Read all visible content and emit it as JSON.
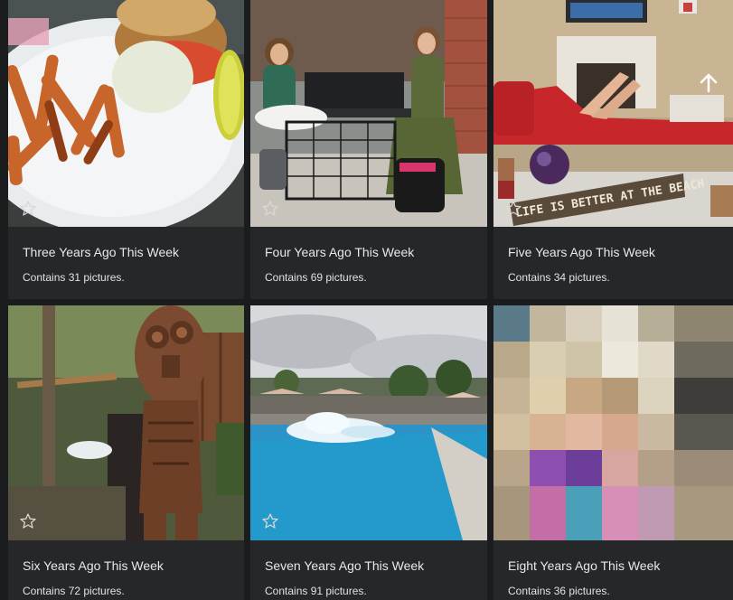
{
  "albums": [
    {
      "title": "Three Years Ago This Week",
      "count": "Contains 31 pictures.",
      "thumb": "plate-of-fries-and-sandwich-photo"
    },
    {
      "title": "Four Years Ago This Week",
      "count": "Contains 69 pictures.",
      "thumb": "two-women-at-patio-table-photo"
    },
    {
      "title": "Five Years Ago This Week",
      "count": "Contains 34 pictures.",
      "thumb": "living-room-feet-on-couch-photo",
      "sign_text": "LIFE IS BETTER AT THE BEACH"
    },
    {
      "title": "Six Years Ago This Week",
      "count": "Contains 72 pictures.",
      "thumb": "carved-wooden-tiki-statue-photo"
    },
    {
      "title": "Seven Years Ago This Week",
      "count": "Contains 91 pictures.",
      "thumb": "swimming-pool-splash-photo"
    },
    {
      "title": "Eight Years Ago This Week",
      "count": "Contains 36 pictures.",
      "thumb": "pixelated-child-drinking-photo"
    }
  ],
  "icons": {
    "favorite": "star-outline-icon",
    "scroll": "arrow-up-icon"
  },
  "colors": {
    "background": "#1b1c1e",
    "card": "#262729",
    "text": "#e8e8e8"
  }
}
